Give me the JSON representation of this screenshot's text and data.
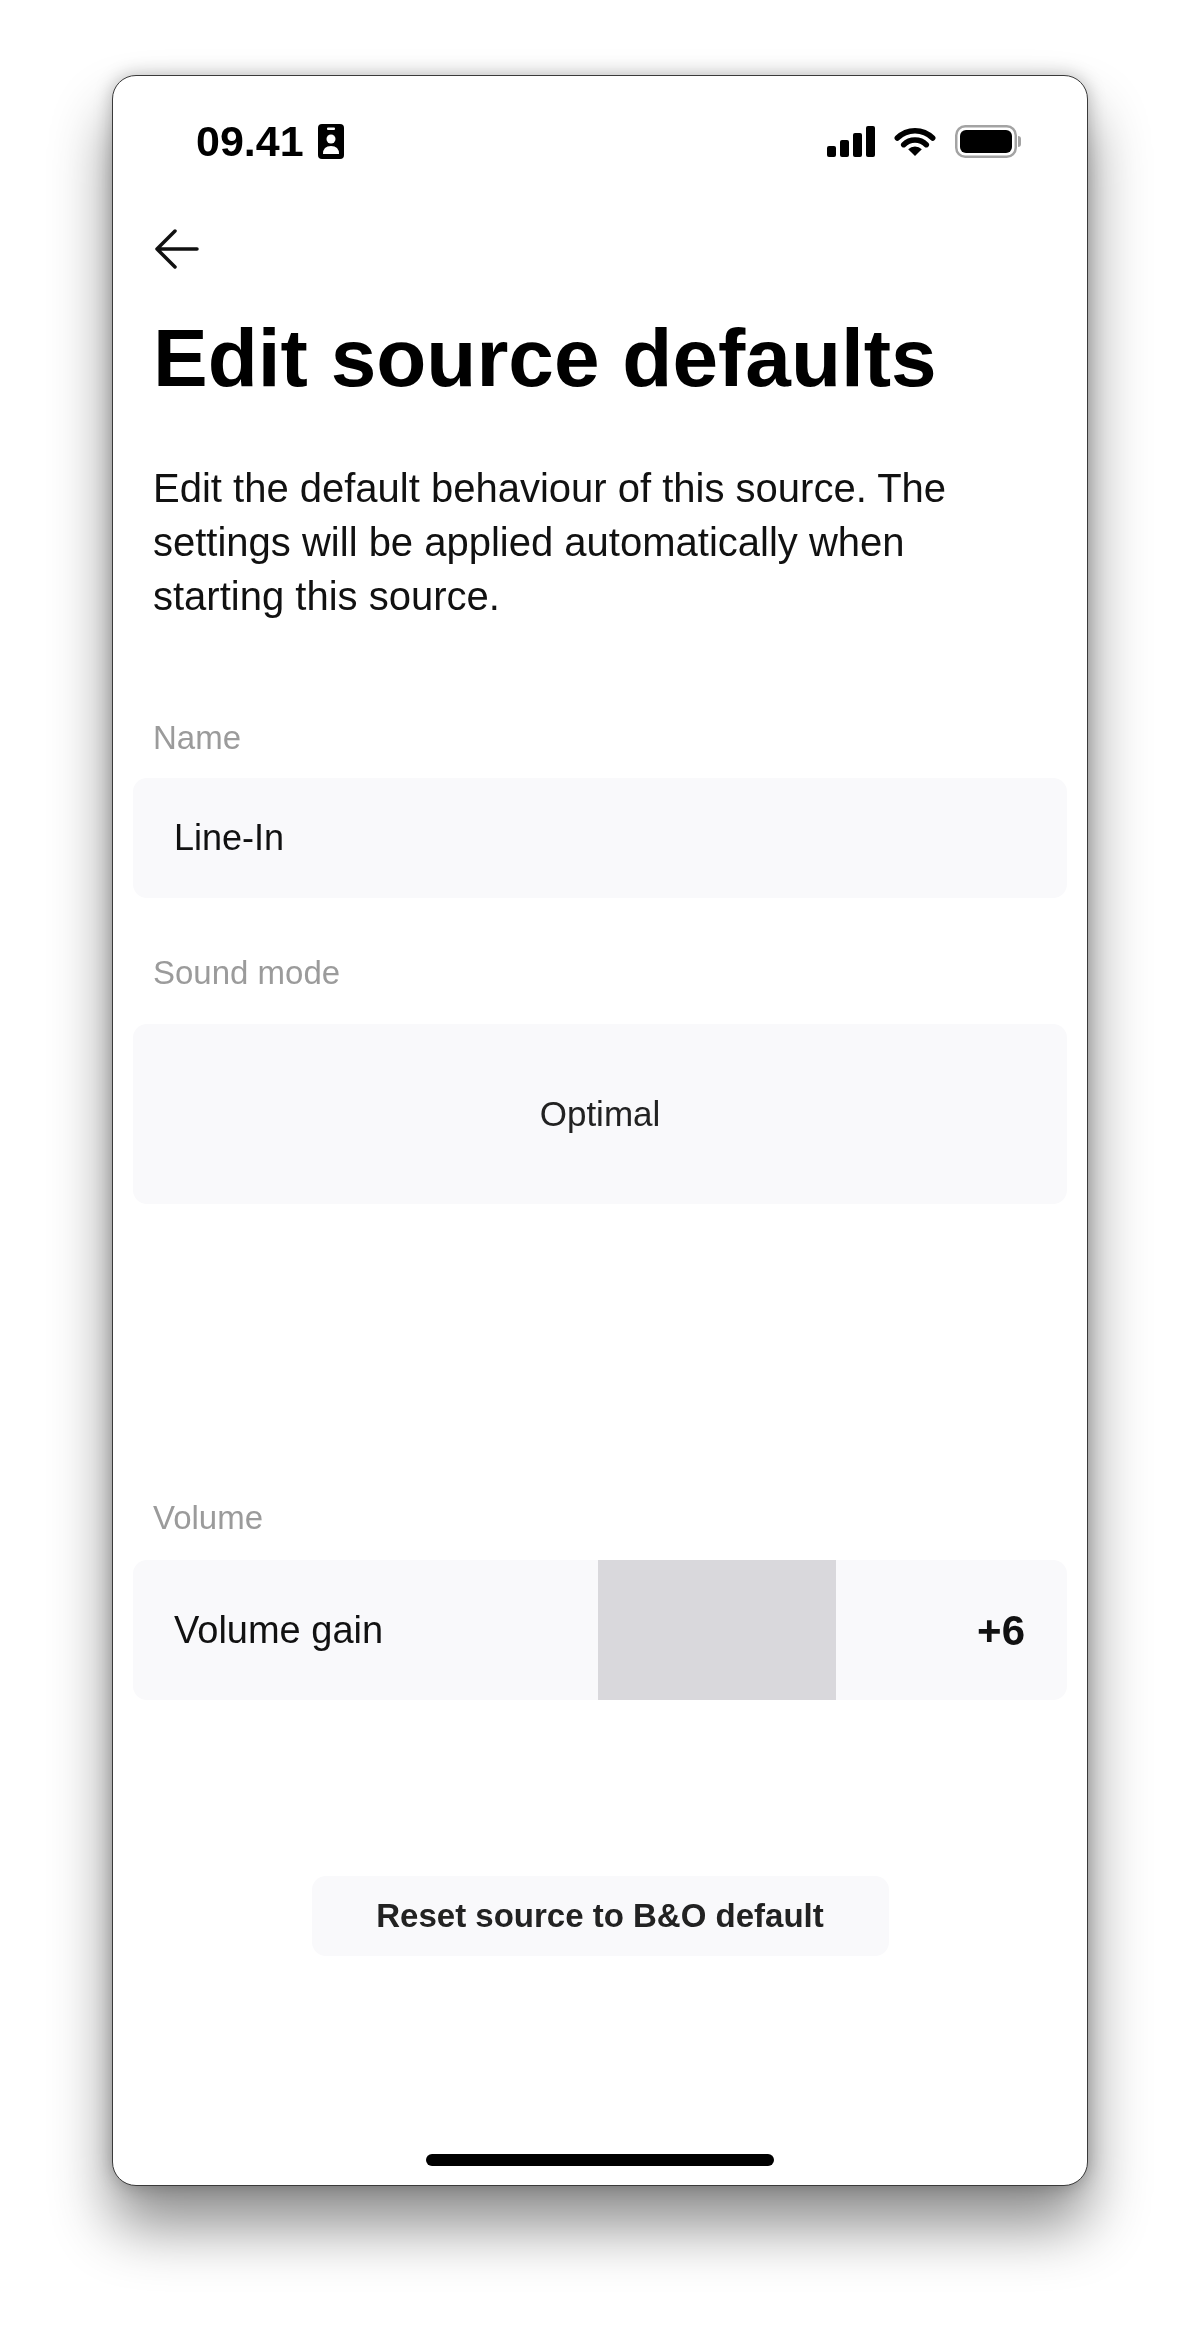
{
  "status_bar": {
    "time": "09.41"
  },
  "header": {
    "title": "Edit source defaults",
    "description": "Edit the default behaviour of this source. The settings will be applied automatically when starting this source."
  },
  "fields": [
    {
      "kind": "text",
      "label": "Name",
      "value": "Line-In"
    },
    {
      "kind": "select",
      "label": "Sound mode",
      "value": "Optimal"
    },
    {
      "kind": "stepper",
      "label": "Volume",
      "title": "Volume gain",
      "value": "+6"
    }
  ],
  "reset_button": {
    "label": "Reset source to B&O default"
  }
}
